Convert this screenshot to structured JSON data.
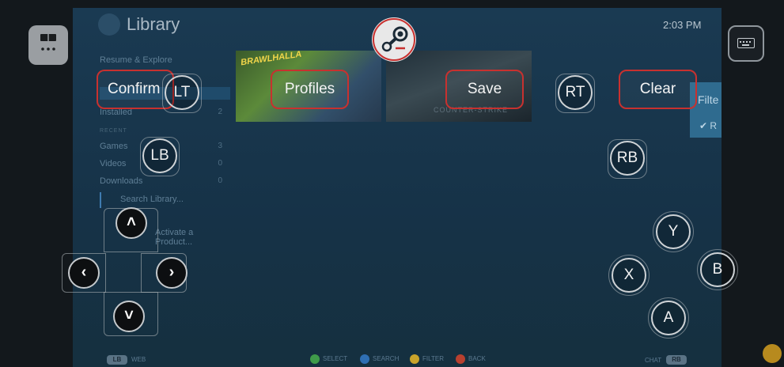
{
  "steam": {
    "title": "Library",
    "clock": "2:03 PM",
    "sidebar": {
      "resume": "Resume & Explore",
      "installed": "Installed",
      "installed_count": "2",
      "section_label": "RECENT",
      "games": "Games",
      "games_count": "3",
      "videos": "Videos",
      "videos_count": "0",
      "downloads": "Downloads",
      "downloads_count": "0",
      "search_placeholder": "Search Library...",
      "activate": "Activate a Product..."
    },
    "tiles": [
      "BRAWLHALLA",
      "COUNTER-STRIKE"
    ],
    "filter_panel": {
      "label": "Filte",
      "check_label": "R"
    },
    "hints": [
      {
        "key": "A",
        "label": "SELECT",
        "color": "#3f9b4a"
      },
      {
        "key": "X",
        "label": "SEARCH",
        "color": "#2f6fb3"
      },
      {
        "key": "Y",
        "label": "FILTER",
        "color": "#c9a42b"
      },
      {
        "key": "B",
        "label": "BACK",
        "color": "#b8402f"
      }
    ],
    "lb_chip": "LB",
    "lb_chip_after": "WEB",
    "chat_label": "CHAT",
    "rb_chip": "RB"
  },
  "overlay": {
    "confirm_label": "Confirm",
    "profiles_label": "Profiles",
    "save_label": "Save",
    "clear_label": "Clear",
    "lt_label": "LT",
    "rt_label": "RT",
    "lb_label": "LB",
    "rb_label": "RB",
    "face": {
      "y": "Y",
      "x": "X",
      "b": "B",
      "a": "A"
    },
    "dpad": {
      "up": "˄",
      "down": "˅",
      "left": "‹",
      "right": "›"
    },
    "accent_color": "#c8312f"
  },
  "icons": {
    "top_left": "keypad-icon",
    "top_right": "keyboard-icon",
    "center": "steam-logo-icon",
    "bottom_right": "app-badge-icon"
  }
}
